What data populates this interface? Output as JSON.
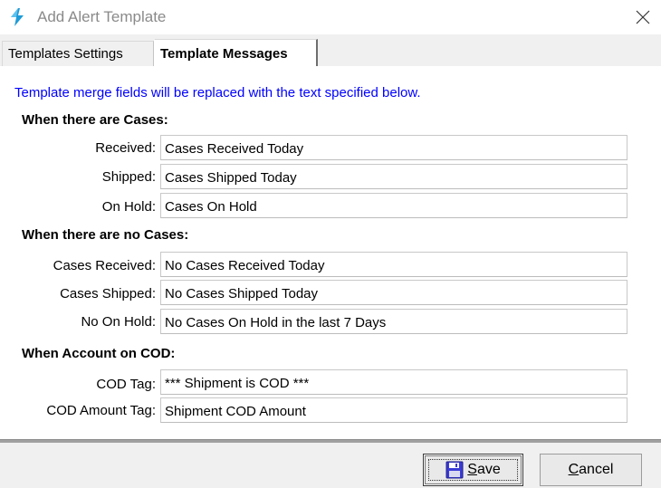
{
  "window": {
    "title": "Add Alert Template",
    "icon": "lightning-logo-icon",
    "accent": "#1e9bd7"
  },
  "tabs": [
    {
      "label": "Templates Settings",
      "active": false
    },
    {
      "label": "Template Messages",
      "active": true
    }
  ],
  "hint": "Template merge fields will be replaced with the text specified below.",
  "sections": {
    "cases": {
      "title": "When there are Cases:",
      "fields": [
        {
          "label": "Received:",
          "value": "Cases Received Today"
        },
        {
          "label": "Shipped:",
          "value": "Cases Shipped Today"
        },
        {
          "label": "On Hold:",
          "value": "Cases On Hold"
        }
      ]
    },
    "no_cases": {
      "title": "When there are no Cases:",
      "fields": [
        {
          "label": "Cases Received:",
          "value": "No Cases Received Today"
        },
        {
          "label": "Cases Shipped:",
          "value": "No Cases Shipped Today"
        },
        {
          "label": "No On Hold:",
          "value": "No Cases On Hold in the last 7 Days"
        }
      ]
    },
    "cod": {
      "title": "When Account on COD:",
      "fields": [
        {
          "label": "COD Tag:",
          "value": "*** Shipment is COD ***"
        },
        {
          "label": "COD Amount Tag:",
          "value": "Shipment COD Amount"
        }
      ]
    }
  },
  "buttons": {
    "save": "Save",
    "cancel": "Cancel"
  },
  "colors": {
    "hint": "#0000ff",
    "save_icon": "#3b3bd6"
  }
}
